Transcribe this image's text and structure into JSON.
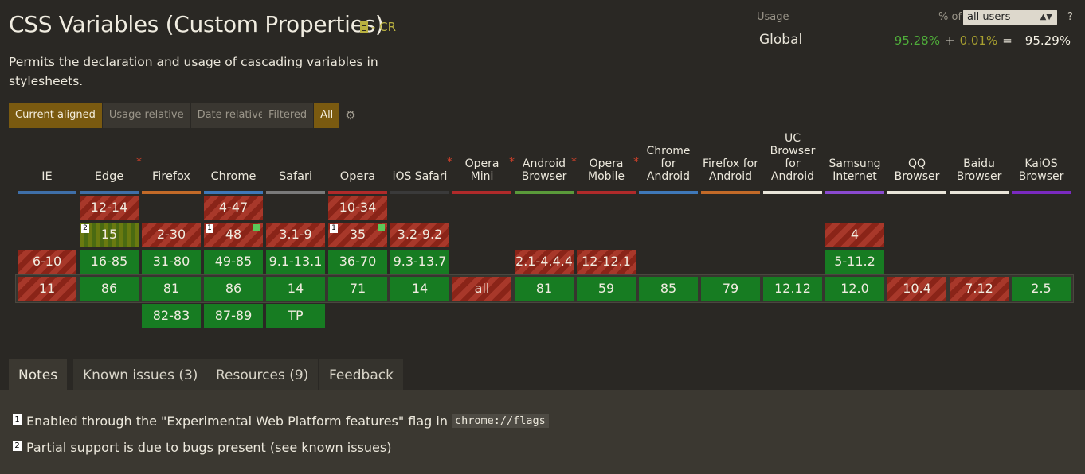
{
  "feature": {
    "title": "CSS Variables (Custom Properties)",
    "spec_status": "- CR",
    "description": "Permits the declaration and usage of cascading variables in stylesheets."
  },
  "view_buttons": [
    "Current aligned",
    "Usage relative",
    "Date relative"
  ],
  "filter_buttons": [
    "Filtered",
    "All"
  ],
  "usage": {
    "label": "Usage",
    "percent_of": "% of",
    "select_value": "all users",
    "help": "?",
    "region": "Global",
    "full": "95.28%",
    "plus": "+",
    "partial": "0.01%",
    "equals": "=",
    "total": "95.29%"
  },
  "browsers": [
    {
      "name": "IE",
      "star": false,
      "color": "#3f6fa8"
    },
    {
      "name": "Edge",
      "star": true,
      "color": "#3f6fa8"
    },
    {
      "name": "Firefox",
      "star": false,
      "color": "#c26a28"
    },
    {
      "name": "Chrome",
      "star": false,
      "color": "#3f78b8"
    },
    {
      "name": "Safari",
      "star": false,
      "color": "#7a7a7a"
    },
    {
      "name": "Opera",
      "star": false,
      "color": "#b02a2a"
    },
    {
      "name": "iOS Safari",
      "star": true,
      "color": "#3a3a3a"
    },
    {
      "name": "Opera Mini",
      "star": true,
      "color": "#b02a2a"
    },
    {
      "name": "Android Browser",
      "star": true,
      "color": "#5a9a3a"
    },
    {
      "name": "Opera Mobile",
      "star": true,
      "color": "#b02a2a"
    },
    {
      "name": "Chrome for Android",
      "star": false,
      "color": "#3f78b8"
    },
    {
      "name": "Firefox for Android",
      "star": false,
      "color": "#c26a28"
    },
    {
      "name": "UC Browser for Android",
      "star": false,
      "color": "#e8e4d8"
    },
    {
      "name": "Samsung Internet",
      "star": false,
      "color": "#8a4ad0"
    },
    {
      "name": "QQ Browser",
      "star": false,
      "color": "#e8e4d8"
    },
    {
      "name": "Baidu Browser",
      "star": false,
      "color": "#e8e4d8"
    },
    {
      "name": "KaiOS Browser",
      "star": false,
      "color": "#7a2ac0"
    }
  ],
  "support_cells": [
    {
      "col": 1,
      "row": 0,
      "v": "12-14",
      "s": "n"
    },
    {
      "col": 3,
      "row": 0,
      "v": "4-47",
      "s": "n"
    },
    {
      "col": 5,
      "row": 0,
      "v": "10-34",
      "s": "n"
    },
    {
      "col": 1,
      "row": 1,
      "v": "15",
      "s": "p",
      "note": "2"
    },
    {
      "col": 2,
      "row": 1,
      "v": "2-30",
      "s": "n"
    },
    {
      "col": 3,
      "row": 1,
      "v": "48",
      "s": "n",
      "note": "1",
      "flag": true
    },
    {
      "col": 4,
      "row": 1,
      "v": "3.1-9",
      "s": "n"
    },
    {
      "col": 5,
      "row": 1,
      "v": "35",
      "s": "n",
      "note": "1",
      "flag": true
    },
    {
      "col": 6,
      "row": 1,
      "v": "3.2-9.2",
      "s": "n"
    },
    {
      "col": 13,
      "row": 1,
      "v": "4",
      "s": "n"
    },
    {
      "col": 0,
      "row": 2,
      "v": "6-10",
      "s": "n"
    },
    {
      "col": 1,
      "row": 2,
      "v": "16-85",
      "s": "y"
    },
    {
      "col": 2,
      "row": 2,
      "v": "31-80",
      "s": "y"
    },
    {
      "col": 3,
      "row": 2,
      "v": "49-85",
      "s": "y"
    },
    {
      "col": 4,
      "row": 2,
      "v": "9.1-13.1",
      "s": "y"
    },
    {
      "col": 5,
      "row": 2,
      "v": "36-70",
      "s": "y"
    },
    {
      "col": 6,
      "row": 2,
      "v": "9.3-13.7",
      "s": "y"
    },
    {
      "col": 8,
      "row": 2,
      "v": "2.1-4.4.4",
      "s": "n"
    },
    {
      "col": 9,
      "row": 2,
      "v": "12-12.1",
      "s": "n"
    },
    {
      "col": 13,
      "row": 2,
      "v": "5-11.2",
      "s": "y"
    },
    {
      "col": 0,
      "row": 3,
      "v": "11",
      "s": "n"
    },
    {
      "col": 1,
      "row": 3,
      "v": "86",
      "s": "y"
    },
    {
      "col": 2,
      "row": 3,
      "v": "81",
      "s": "y"
    },
    {
      "col": 3,
      "row": 3,
      "v": "86",
      "s": "y"
    },
    {
      "col": 4,
      "row": 3,
      "v": "14",
      "s": "y"
    },
    {
      "col": 5,
      "row": 3,
      "v": "71",
      "s": "y"
    },
    {
      "col": 6,
      "row": 3,
      "v": "14",
      "s": "y"
    },
    {
      "col": 7,
      "row": 3,
      "v": "all",
      "s": "n"
    },
    {
      "col": 8,
      "row": 3,
      "v": "81",
      "s": "y"
    },
    {
      "col": 9,
      "row": 3,
      "v": "59",
      "s": "y"
    },
    {
      "col": 10,
      "row": 3,
      "v": "85",
      "s": "y"
    },
    {
      "col": 11,
      "row": 3,
      "v": "79",
      "s": "y"
    },
    {
      "col": 12,
      "row": 3,
      "v": "12.12",
      "s": "y"
    },
    {
      "col": 13,
      "row": 3,
      "v": "12.0",
      "s": "y"
    },
    {
      "col": 14,
      "row": 3,
      "v": "10.4",
      "s": "n"
    },
    {
      "col": 15,
      "row": 3,
      "v": "7.12",
      "s": "n"
    },
    {
      "col": 16,
      "row": 3,
      "v": "2.5",
      "s": "y"
    },
    {
      "col": 2,
      "row": 4,
      "v": "82-83",
      "s": "y"
    },
    {
      "col": 3,
      "row": 4,
      "v": "87-89",
      "s": "y"
    },
    {
      "col": 4,
      "row": 4,
      "v": "TP",
      "s": "y"
    }
  ],
  "tabs": [
    "Notes",
    "Known issues (3)",
    "Resources (9)",
    "Feedback"
  ],
  "notes": [
    {
      "num": "1",
      "text": "Enabled through the \"Experimental Web Platform features\" flag in",
      "code": "chrome://flags"
    },
    {
      "num": "2",
      "text": "Partial support is due to bugs present (see known issues)",
      "code": ""
    }
  ]
}
